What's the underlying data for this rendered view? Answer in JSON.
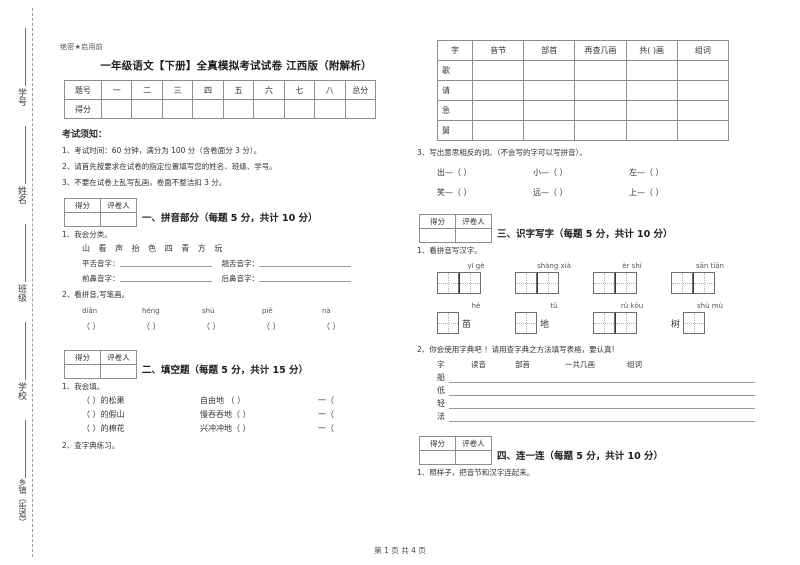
{
  "document": {
    "secret_mark": "绝密★启用前",
    "title": "一年级语文【下册】全真模拟考试试卷 江西版（附解析）",
    "footer": "第 1 页 共 4 页"
  },
  "seal_sidebar": {
    "labels": [
      "学号",
      "姓名",
      "班级",
      "学校",
      "乡镇（街道）"
    ]
  },
  "score_table": {
    "row_label_1": "题号",
    "row_label_2": "得分",
    "columns": [
      "一",
      "二",
      "三",
      "四",
      "五",
      "六",
      "七",
      "八",
      "总分"
    ]
  },
  "notice": {
    "heading": "考试须知：",
    "items": [
      "1、考试时间：60 分钟，满分为 100 分（含卷面分 3 分）。",
      "2、请首先按要求在试卷的指定位置填写您的姓名、班级、学号。",
      "3、不要在试卷上乱写乱画，卷面不整洁扣 3 分。"
    ]
  },
  "score_box": {
    "score_label": "得分",
    "marker_label": "评卷人"
  },
  "sections": [
    {
      "id": "s1",
      "heading": "一、拼音部分（每题 5 分，共计 10 分）",
      "q1": {
        "prompt": "1、我会分类。",
        "characters": "山 看 声 抬 色 四 青 方 玩",
        "blank_labels": [
          "平舌音字：",
          "翘舌音字：",
          "前鼻音字：",
          "后鼻音字："
        ]
      },
      "q2": {
        "prompt": "2、看拼音,写笔画。",
        "pinyin": [
          "diǎn",
          "héng",
          "shù",
          "piě",
          "nà"
        ],
        "answer_slot": "（        ）"
      }
    },
    {
      "id": "s2",
      "heading": "二、填空题（每题 5 分，共计 15 分）",
      "q1": {
        "prompt": "1、我会填。",
        "rows": [
          {
            "left": "（             ）的松果",
            "mid": "自由地  （          ）",
            "right": "一（"
          },
          {
            "left": "（             ）的假山",
            "mid": "慢吞吞地（          ）",
            "right": "一（"
          },
          {
            "left": "（             ）的棉花",
            "mid": "兴冲冲地（          ）",
            "right": "一（"
          }
        ]
      },
      "q2": {
        "prompt": "2、查字典练习。"
      }
    },
    {
      "id": "s3",
      "heading": "三、识字写字（每题 5 分，共计 10 分）",
      "q1": {
        "prompt": "1、看拼音写汉字。",
        "row1": [
          {
            "pinyin": "yī  gè",
            "cells": 2
          },
          {
            "pinyin": "shàng xià",
            "cells": 2
          },
          {
            "pinyin": "èr  shí",
            "cells": 2
          },
          {
            "pinyin": "sān tiān",
            "cells": 2
          }
        ],
        "row2": [
          {
            "pinyin": "hé",
            "cells": 1,
            "suffix": "苗"
          },
          {
            "pinyin": "tǔ",
            "cells": 1,
            "suffix": "地"
          },
          {
            "pinyin": "rù  kǒu",
            "cells": 2,
            "suffix": ""
          },
          {
            "pinyin": "shù  mù",
            "cells": 1,
            "prefix": "树"
          }
        ]
      },
      "q2": {
        "prompt": "2、你会使用字典吧 ！请用查字典之方法填写表格，要认真!",
        "columns": [
          "字",
          "读音",
          "部首",
          "一共几画",
          "组词"
        ],
        "characters": [
          "船",
          "低",
          "轻",
          "法"
        ]
      }
    },
    {
      "id": "s4",
      "heading": "四、连一连（每题 5 分，共计 10 分）",
      "q1": {
        "prompt": "1、照样子，把音节和汉字连起来。"
      }
    }
  ],
  "lookup_table": {
    "columns": [
      "字",
      "音节",
      "部首",
      "再查几画",
      "共(    )画",
      "组词"
    ],
    "rows": [
      "歌",
      "请",
      "急",
      "舅"
    ]
  },
  "antonyms": {
    "prompt": "3、写出意思相反的词。（不会写的字可以写拼音）。",
    "row1": [
      "出—（        ）",
      "小—（        ）",
      "左—（        ）"
    ],
    "row2": [
      "笑—（        ）",
      "远—（        ）",
      "上—（        ）"
    ]
  }
}
